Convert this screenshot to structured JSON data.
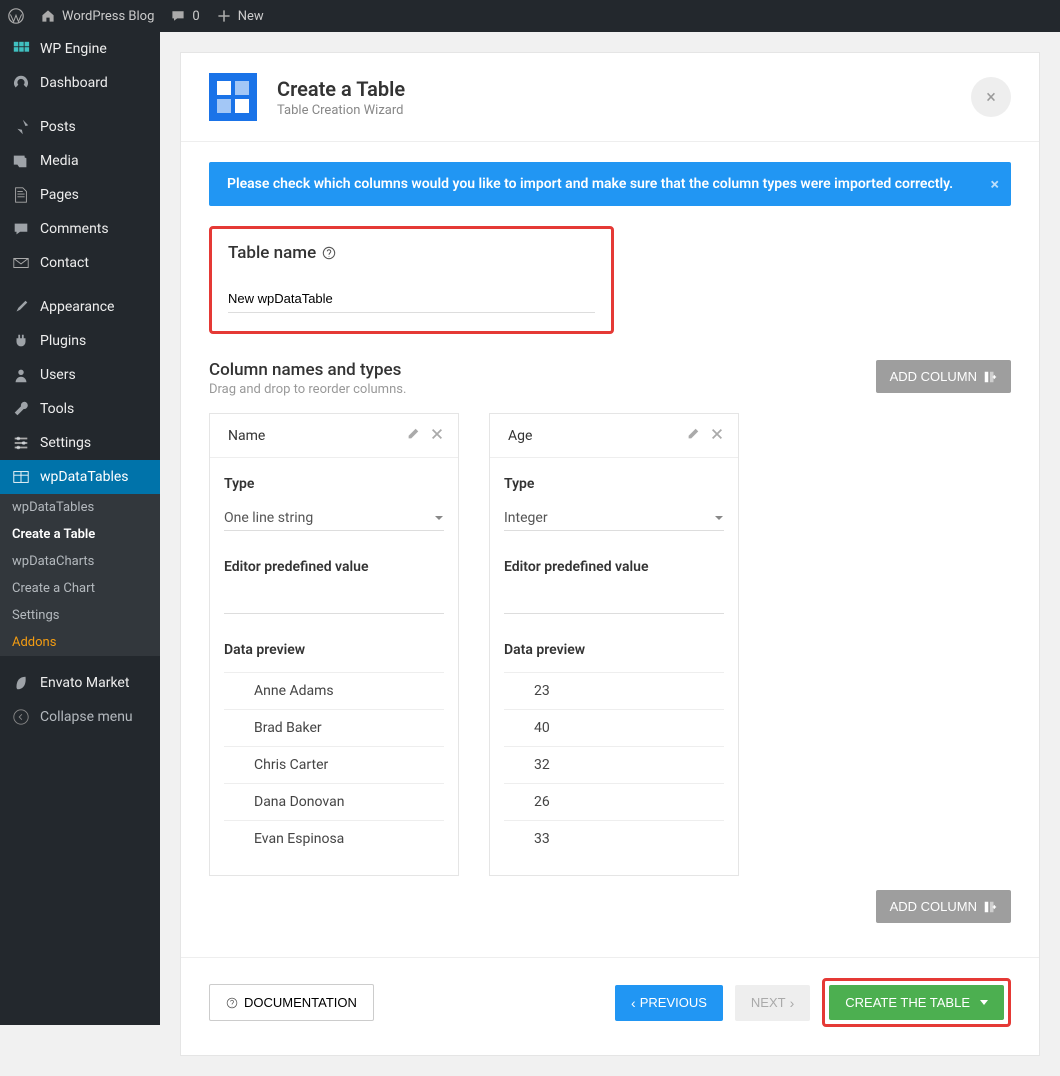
{
  "adminBar": {
    "siteName": "WordPress Blog",
    "comments": "0",
    "newLabel": "New"
  },
  "sidebar": {
    "items": [
      {
        "label": "WP Engine"
      },
      {
        "label": "Dashboard"
      },
      {
        "label": "Posts"
      },
      {
        "label": "Media"
      },
      {
        "label": "Pages"
      },
      {
        "label": "Comments"
      },
      {
        "label": "Contact"
      },
      {
        "label": "Appearance"
      },
      {
        "label": "Plugins"
      },
      {
        "label": "Users"
      },
      {
        "label": "Tools"
      },
      {
        "label": "Settings"
      },
      {
        "label": "wpDataTables"
      },
      {
        "label": "Envato Market"
      }
    ],
    "submenu": [
      "wpDataTables",
      "Create a Table",
      "wpDataCharts",
      "Create a Chart",
      "Settings",
      "Addons"
    ],
    "collapse": "Collapse menu"
  },
  "page": {
    "title": "Create a Table",
    "subtitle": "Table Creation Wizard",
    "alert": "Please check which columns would you like to import and make sure that the column types were imported correctly.",
    "tableNameLabel": "Table name",
    "tableNameValue": "New wpDataTable",
    "columnsTitle": "Column names and types",
    "columnsSub": "Drag and drop to reorder columns.",
    "addColumn": "ADD COLUMN",
    "typeLabel": "Type",
    "predefinedLabel": "Editor predefined value",
    "previewLabel": "Data preview",
    "documentation": "DOCUMENTATION",
    "previous": "PREVIOUS",
    "next": "NEXT",
    "createTable": "CREATE THE TABLE"
  },
  "columns": [
    {
      "name": "Name",
      "type": "One line string",
      "preview": [
        "Anne Adams",
        "Brad Baker",
        "Chris Carter",
        "Dana Donovan",
        "Evan Espinosa"
      ]
    },
    {
      "name": "Age",
      "type": "Integer",
      "preview": [
        "23",
        "40",
        "32",
        "26",
        "33"
      ]
    }
  ]
}
